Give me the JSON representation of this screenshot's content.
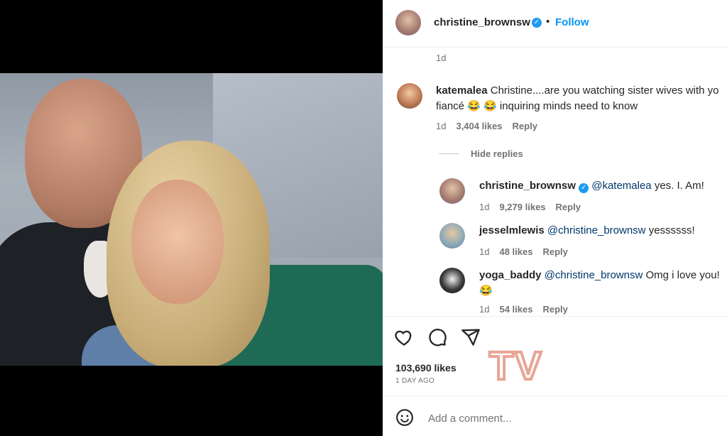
{
  "post": {
    "username": "christine_brownsw",
    "dot": "•",
    "follow_label": "Follow",
    "caption_time": "1d"
  },
  "comments": [
    {
      "username": "katemalea",
      "text_line1": "Christine....are you watching sister wives with yo",
      "text_line2": "fiancé 😂 😂 inquiring minds need to know",
      "time": "1d",
      "likes": "3,404 likes",
      "reply_label": "Reply"
    }
  ],
  "hide_replies_label": "Hide replies",
  "replies": [
    {
      "username": "christine_brownsw",
      "mention": "@katemalea",
      "text": "yes. I. Am!",
      "time": "1d",
      "likes": "9,279 likes",
      "reply_label": "Reply"
    },
    {
      "username": "jesselmlewis",
      "mention": "@christine_brownsw",
      "text": "yessssss!",
      "time": "1d",
      "likes": "48 likes",
      "reply_label": "Reply"
    },
    {
      "username": "yoga_baddy",
      "mention": "@christine_brownsw",
      "text": "Omg i love you!",
      "text_line2": "😂",
      "time": "1d",
      "likes": "54 likes",
      "reply_label": "Reply"
    }
  ],
  "actions": {
    "like_icon": "heart-icon",
    "comment_icon": "comment-icon",
    "share_icon": "share-icon"
  },
  "likes_count": "103,690 likes",
  "posted_ago": "1 DAY AGO",
  "watermark": "TV",
  "add_comment_placeholder": "Add a comment...",
  "colors": {
    "follow": "#0095f6",
    "verified": "#1d9bf0",
    "watermark": "#e8a596"
  }
}
